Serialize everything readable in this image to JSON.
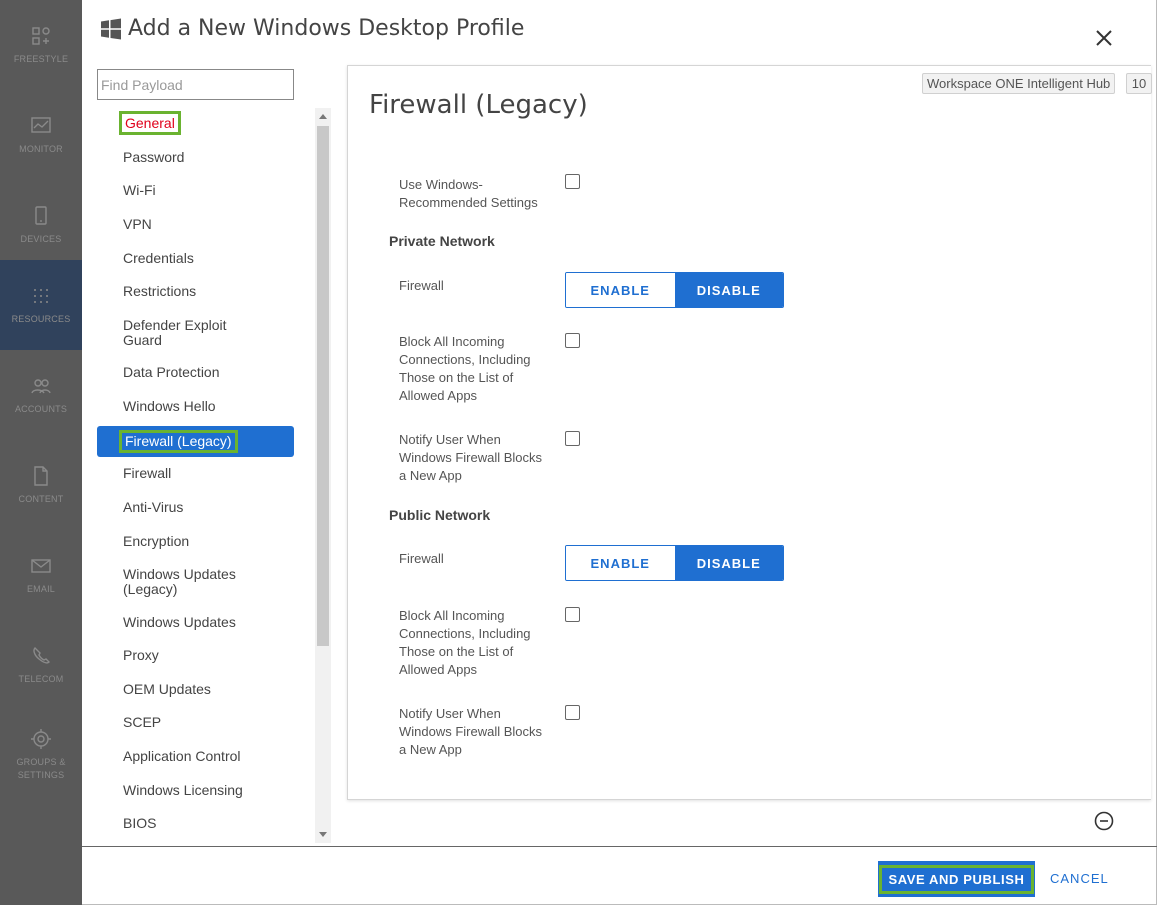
{
  "rail": [
    {
      "label": "FREESTYLE",
      "icon": "freestyle-icon"
    },
    {
      "label": "MONITOR",
      "icon": "monitor-icon"
    },
    {
      "label": "DEVICES",
      "icon": "devices-icon"
    },
    {
      "label": "RESOURCES",
      "icon": "resources-icon"
    },
    {
      "label": "ACCOUNTS",
      "icon": "accounts-icon"
    },
    {
      "label": "CONTENT",
      "icon": "content-icon"
    },
    {
      "label": "EMAIL",
      "icon": "email-icon"
    },
    {
      "label": "TELECOM",
      "icon": "telecom-icon"
    },
    {
      "label": "GROUPS & SETTINGS",
      "icon": "settings-icon"
    }
  ],
  "modal": {
    "title": "Add a New Windows Desktop Profile",
    "search_placeholder": "Find Payload"
  },
  "payloads": [
    "General",
    "Password",
    "Wi-Fi",
    "VPN",
    "Credentials",
    "Restrictions",
    "Defender Exploit Guard",
    "Data Protection",
    "Windows Hello",
    "Firewall (Legacy)",
    "Firewall",
    "Anti-Virus",
    "Encryption",
    "Windows Updates (Legacy)",
    "Windows Updates",
    "Proxy",
    "OEM Updates",
    "SCEP",
    "Application Control",
    "Windows Licensing",
    "BIOS"
  ],
  "panel": {
    "title": "Firewall (Legacy)",
    "hub_badge": "Workspace ONE Intelligent Hub",
    "version_badge": "10",
    "use_recommended": "Use Windows-Recommended Settings",
    "private": {
      "title": "Private Network",
      "firewall_label": "Firewall",
      "enable": "ENABLE",
      "disable": "DISABLE",
      "block_label": "Block All Incoming Connections, Including Those on the List of Allowed Apps",
      "notify_label": "Notify User When Windows Firewall Blocks a New App"
    },
    "public": {
      "title": "Public Network",
      "firewall_label": "Firewall",
      "enable": "ENABLE",
      "disable": "DISABLE",
      "block_label": "Block All Incoming Connections, Including Those on the List of Allowed Apps",
      "notify_label": "Notify User When Windows Firewall Blocks a New App"
    }
  },
  "footer": {
    "save": "SAVE AND PUBLISH",
    "cancel": "CANCEL"
  },
  "colors": {
    "accent": "#1f6fd1",
    "highlight": "#6ab330",
    "rail": "#595959"
  }
}
